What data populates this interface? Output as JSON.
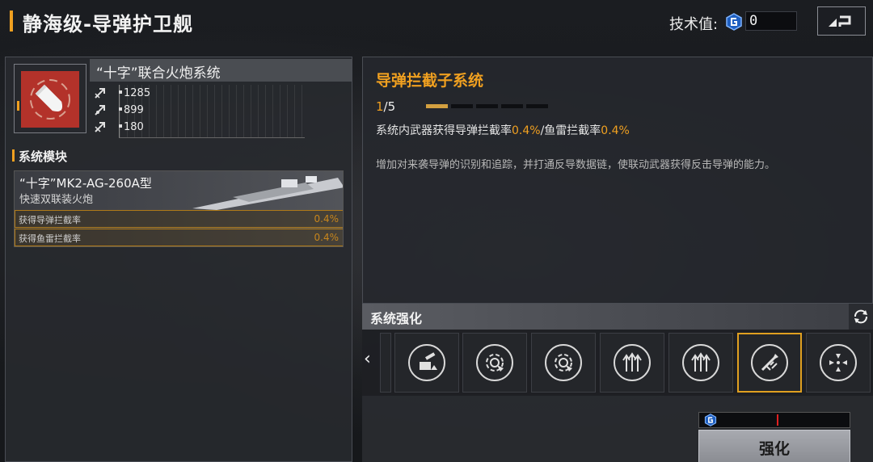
{
  "header": {
    "title": "静海级-导弹护卫舰",
    "tech_label": "技术值:",
    "tech_value": "0"
  },
  "weapon": {
    "name": "“十字”联合火炮系统",
    "stats": [
      "1285",
      "899",
      "180"
    ]
  },
  "modules": {
    "section_title": "系统模块",
    "card": {
      "title": "“十字”MK2-AG-260A型",
      "subtitle": "快速双联装火炮",
      "effects": [
        {
          "label": "获得导弹拦截率",
          "value": "0.4%"
        },
        {
          "label": "获得鱼雷拦截率",
          "value": "0.4%"
        }
      ]
    }
  },
  "subsystem": {
    "title": "导弹拦截子系统",
    "progress_current": "1",
    "progress_total": "/5",
    "progress_level": 1,
    "progress_max": 5,
    "effect_prefix": "系统内武器获得导弹拦截率",
    "effect_val1": "0.4%",
    "effect_mid": "/鱼雷拦截率",
    "effect_val2": "0.4%",
    "description": "增加对来袭导弹的识别和追踪，并打通反导数据链，使联动武器获得反击导弹的能力。"
  },
  "enhance": {
    "section_title": "系统强化",
    "button_label": "强化",
    "skills": [
      {
        "icon": "cannon-up-icon",
        "active": false
      },
      {
        "icon": "radar-arrow-icon",
        "active": false
      },
      {
        "icon": "radar-arrow-icon",
        "active": false
      },
      {
        "icon": "triple-arrow-up-icon",
        "active": false
      },
      {
        "icon": "triple-arrow-up-icon",
        "active": false
      },
      {
        "icon": "missile-intercept-icon",
        "active": true
      },
      {
        "icon": "arrows-converge-icon",
        "active": false
      }
    ]
  },
  "colors": {
    "accent": "#f0a020",
    "weapon_icon_bg": "#b3322a",
    "tech_icon": "#2a7de0"
  }
}
